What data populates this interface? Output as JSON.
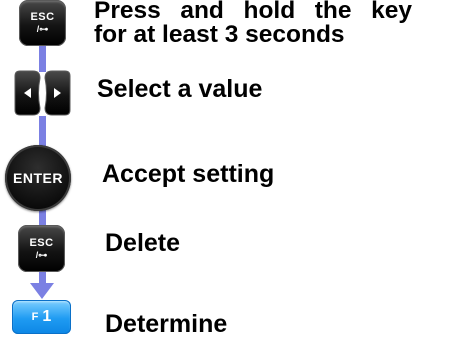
{
  "colors": {
    "connector": "#7b80e3",
    "key_dark": "#111111",
    "key_blue": "#1f9bf2",
    "text": "#000000"
  },
  "steps": [
    {
      "key": {
        "type": "esc-key",
        "line1": "ESC",
        "line2": "/⊶"
      },
      "text_lines": [
        "Press and hold the key",
        "for at least 3 seconds"
      ]
    },
    {
      "key": {
        "type": "left-right-arrow-keys",
        "left_icon": "triangle-left-icon",
        "right_icon": "triangle-right-icon"
      },
      "text": "Select a value"
    },
    {
      "key": {
        "type": "enter-key",
        "label": "ENTER"
      },
      "text": "Accept setting"
    },
    {
      "key": {
        "type": "esc-key",
        "line1": "ESC",
        "line2": "/⊶"
      },
      "text": "Delete"
    },
    {
      "key": {
        "type": "f1-key",
        "prefix": "F",
        "number": "1"
      },
      "text": "Determine"
    }
  ]
}
